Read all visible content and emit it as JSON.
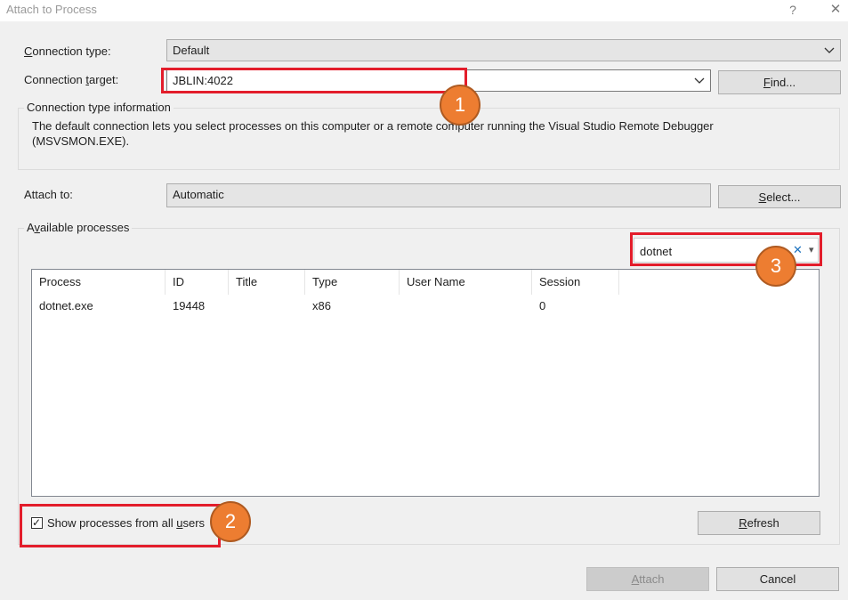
{
  "window": {
    "title": "Attach to Process",
    "help_glyph": "?",
    "close_glyph": "✕"
  },
  "connection": {
    "type_label_accel": "C",
    "type_label_rest": "onnection type:",
    "type_value": "Default",
    "target_label_pre": "Connection ",
    "target_label_accel": "t",
    "target_label_post": "arget:",
    "target_value": "JBLIN:4022",
    "find_button_accel": "F",
    "find_button_rest": "ind..."
  },
  "info": {
    "group_title": "Connection type information",
    "description": "The default connection lets you select processes on this computer or a remote computer running the Visual Studio Remote Debugger (MSVSMON.EXE)."
  },
  "attach_to": {
    "label": "Attach to:",
    "value": "Automatic",
    "select_button_accel": "S",
    "select_button_rest": "elect..."
  },
  "processes": {
    "group_title_pre": "A",
    "group_title_accel": "v",
    "group_title_post": "ailable processes",
    "filter_value": "dotnet",
    "filter_clear_glyph": "✕",
    "filter_dropdown_glyph": "▾",
    "columns": [
      "Process",
      "ID",
      "Title",
      "Type",
      "User Name",
      "Session"
    ],
    "rows": [
      {
        "process": "dotnet.exe",
        "id": "19448",
        "title": "",
        "type": "x86",
        "user": "",
        "session": "0"
      }
    ],
    "show_all_label_pre": "Show processes from all ",
    "show_all_label_accel": "u",
    "show_all_label_post": "sers",
    "show_all_checked": true,
    "checkmark_glyph": "✓",
    "refresh_button_accel": "R",
    "refresh_button_rest": "efresh"
  },
  "footer": {
    "attach_button_accel": "A",
    "attach_button_rest": "ttach",
    "attach_enabled": false,
    "cancel_button": "Cancel"
  },
  "callouts": {
    "badge_1": "1",
    "badge_2": "2",
    "badge_3": "3",
    "color": "#ed7d31",
    "highlight_color": "#e31d2b"
  }
}
